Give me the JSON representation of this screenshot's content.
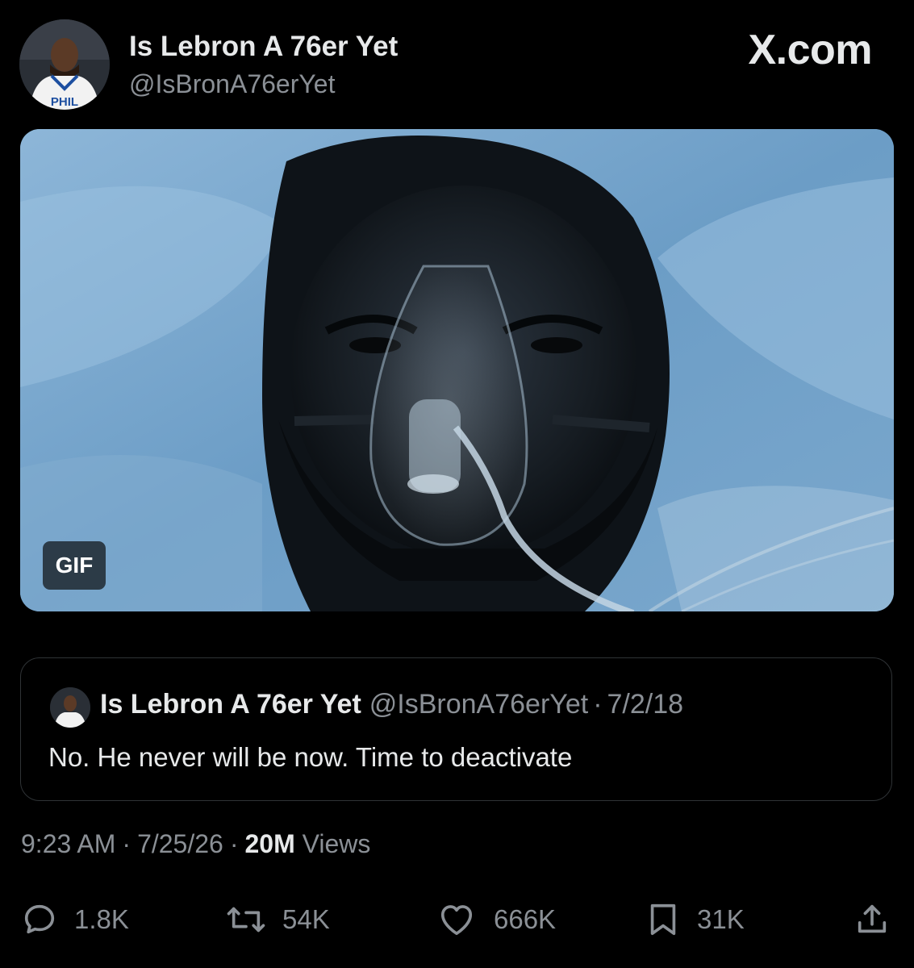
{
  "header": {
    "display_name": "Is Lebron A 76er Yet",
    "handle": "@IsBronA76erYet",
    "brand": "X.com",
    "avatar_jersey_text": "PHIL"
  },
  "media": {
    "badge": "GIF"
  },
  "quoted_post": {
    "display_name": "Is Lebron A 76er Yet",
    "handle": "@IsBronA76erYet",
    "separator": "·",
    "date": "7/2/18",
    "text": "No. He never will be now. Time to deactivate"
  },
  "meta": {
    "time": "9:23 AM",
    "separator": "·",
    "date": "7/25/26",
    "views_count": "20M",
    "views_label": "Views"
  },
  "actions": {
    "replies": "1.8K",
    "reposts": "54K",
    "likes": "666K",
    "bookmarks": "31K"
  },
  "icons": {
    "reply": "reply-icon",
    "repost": "repost-icon",
    "like": "heart-icon",
    "bookmark": "bookmark-icon",
    "share": "share-icon"
  },
  "colors": {
    "background": "#000000",
    "primary_text": "#e7e9ea",
    "secondary_text": "#8b9096",
    "border": "#2f3336"
  }
}
